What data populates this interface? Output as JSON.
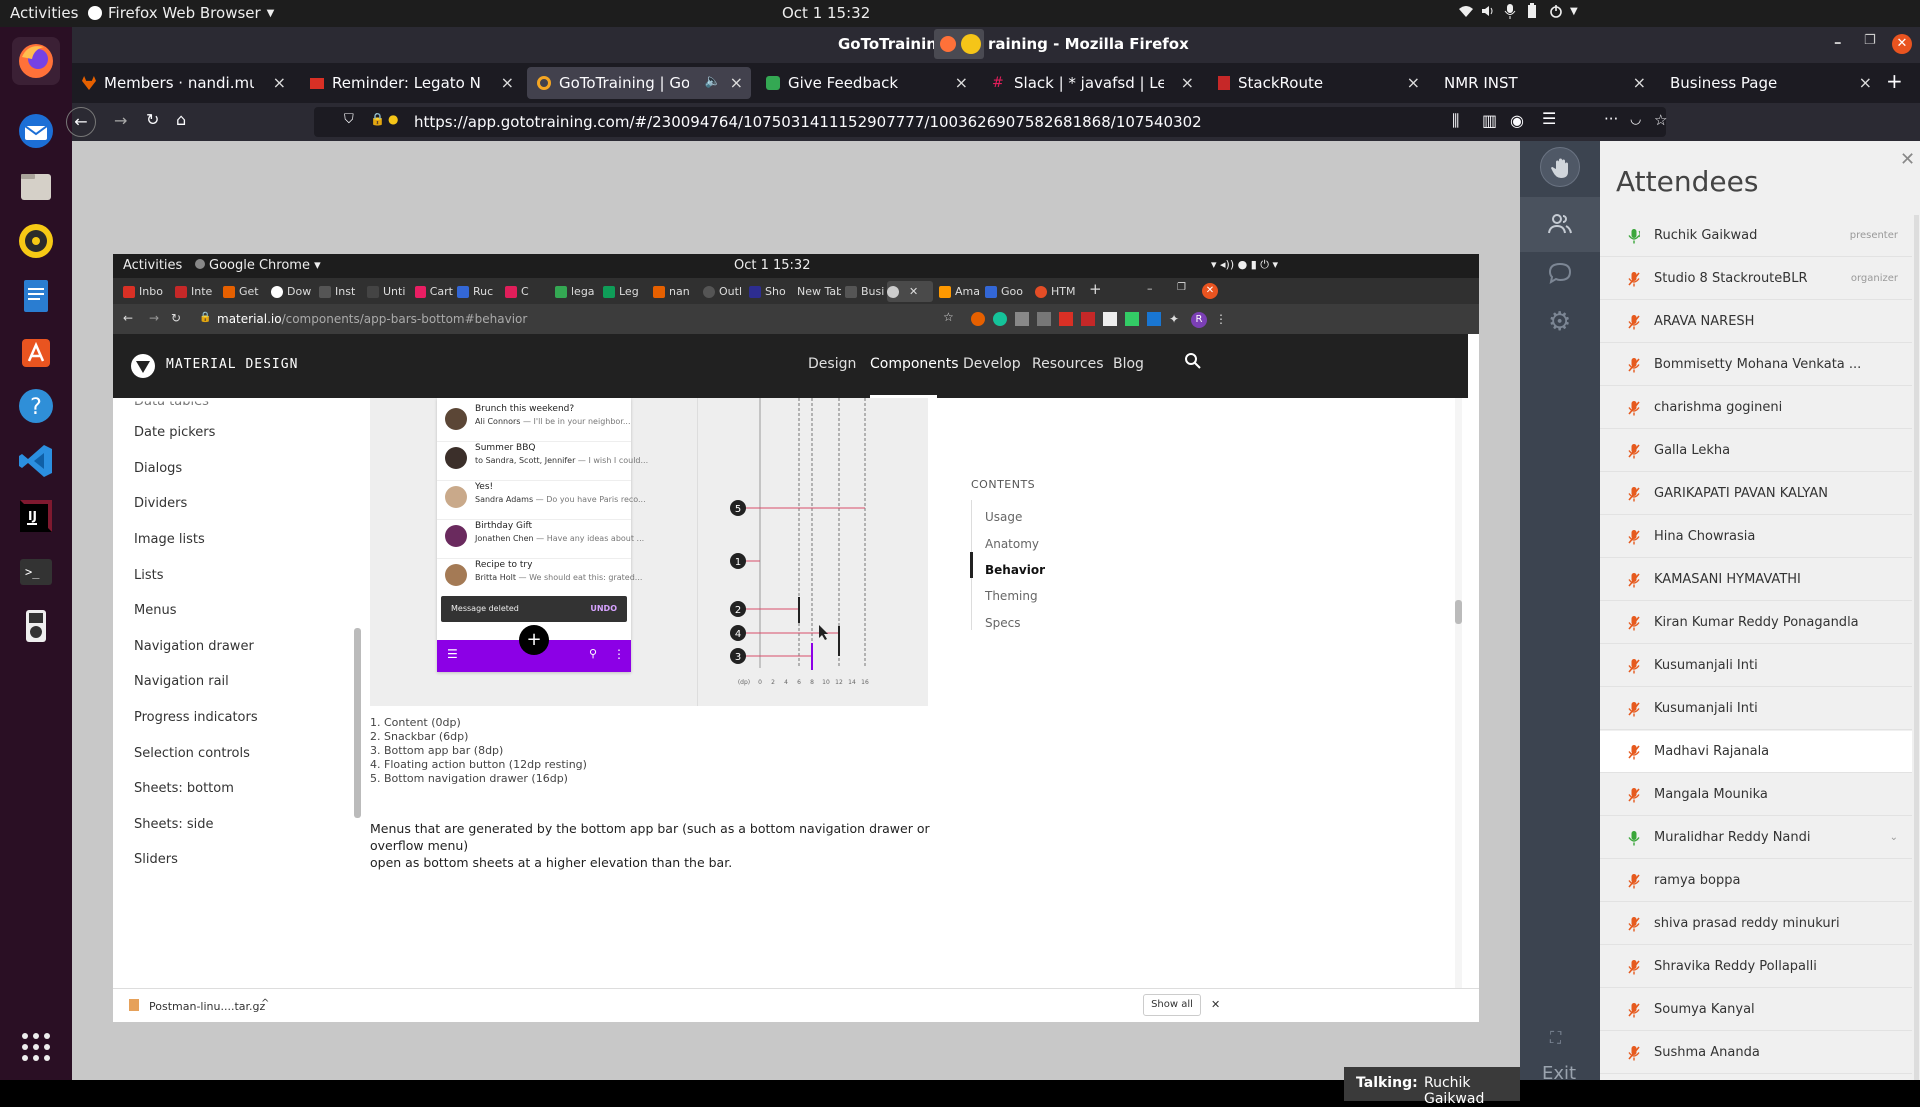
{
  "system": {
    "activities": "Activities",
    "app_menu": "Firefox Web Browser",
    "clock": "Oct 1  15:32"
  },
  "firefox": {
    "window_title": "GoToTraining",
    "window_title_rest": "raining - Mozilla Firefox",
    "tabs": [
      {
        "label": "Members · nandi.muralid",
        "color": "#e66000"
      },
      {
        "label": "Reminder: Legato NHT W",
        "color": "#d93025"
      },
      {
        "label": "GoToTraining | GoToT",
        "color": "#f5a623"
      },
      {
        "label": "Give Feedback",
        "color": "#34a853"
      },
      {
        "label": "Slack | * javafsd | Legato",
        "color": "#e01e5a"
      },
      {
        "label": "StackRoute",
        "color": "#c62828"
      },
      {
        "label": "NMR INST",
        "color": ""
      },
      {
        "label": "Business Page",
        "color": ""
      }
    ],
    "url": "https://app.gototraining.com/#/230094764/1075031411152907777/1003626907582681868/107540302"
  },
  "shared_screen": {
    "activities": "Activities",
    "app_menu": "Google Chrome",
    "clock": "Oct 1  15:32",
    "tabs": [
      "Inbo",
      "Inte",
      "Get",
      "Dow",
      "Inst",
      "Unti",
      "Cart",
      "Ruc",
      "C",
      "lega",
      "Leg",
      "nan",
      "Outl",
      "Sho",
      "New Tab",
      "Busi",
      "",
      "Ama",
      "Goo",
      "HTM"
    ],
    "url_host": "material.io",
    "url_path": "/components/app-bars-bottom#behavior",
    "md_title": "MATERIAL DESIGN",
    "md_nav": [
      "Design",
      "Components",
      "Develop",
      "Resources",
      "Blog"
    ],
    "sidebar": [
      "Data tables",
      "Date pickers",
      "Dialogs",
      "Dividers",
      "Image lists",
      "Lists",
      "Menus",
      "Navigation drawer",
      "Navigation rail",
      "Progress indicators",
      "Selection controls",
      "Sheets: bottom",
      "Sheets: side",
      "Sliders"
    ],
    "emails": [
      {
        "subject": "Brunch this weekend?",
        "from": "Ali Connors",
        "snippet": " — I'll be in your neighbor..."
      },
      {
        "subject": "Summer BBQ",
        "from": "to Sandra, Scott, Jennifer",
        "snippet": " — I wish I could..."
      },
      {
        "subject": "Yes!",
        "from": "Sandra Adams",
        "snippet": " — Do you have Paris reco..."
      },
      {
        "subject": "Birthday Gift",
        "from": "Jonathen Chen",
        "snippet": " — Have any ideas about ..."
      },
      {
        "subject": "Recipe to try",
        "from": "Britta Holt",
        "snippet": " — We should eat this: grated..."
      }
    ],
    "snackbar": {
      "text": "Message deleted",
      "action": "UNDO"
    },
    "elevation_labels": [
      "5",
      "1",
      "2",
      "4",
      "3"
    ],
    "elevation_axis": [
      "(dp)",
      "0",
      "2",
      "4",
      "6",
      "8",
      "10",
      "12",
      "14",
      "16"
    ],
    "contents_title": "CONTENTS",
    "contents": [
      "Usage",
      "Anatomy",
      "Behavior",
      "Theming",
      "Specs"
    ],
    "legend": [
      "1. Content (0dp)",
      "2. Snackbar (6dp)",
      "3. Bottom app bar (8dp)",
      "4. Floating action button (12dp resting)",
      "5. Bottom navigation drawer (16dp)"
    ],
    "paragraph_1": "Menus that are generated by the bottom app bar (such as a bottom navigation drawer or overflow menu)",
    "paragraph_2": "open as bottom sheets at a higher elevation than the bar.",
    "download_file": "Postman-linu....tar.gz",
    "show_all": "Show all"
  },
  "attendees": {
    "title": "Attendees",
    "list": [
      {
        "name": "Ruchik Gaikwad",
        "role": "presenter",
        "mic": "active"
      },
      {
        "name": "Studio 8 StackrouteBLR",
        "role": "organizer",
        "mic": "muted"
      },
      {
        "name": "ARAVA NARESH",
        "role": "",
        "mic": "muted"
      },
      {
        "name": "Bommisetty Mohana Venkata ...",
        "role": "",
        "mic": "muted"
      },
      {
        "name": "charishma gogineni",
        "role": "",
        "mic": "muted"
      },
      {
        "name": "Galla Lekha",
        "role": "",
        "mic": "muted"
      },
      {
        "name": "GARIKAPATI PAVAN KALYAN",
        "role": "",
        "mic": "muted"
      },
      {
        "name": "Hina Chowrasia",
        "role": "",
        "mic": "muted"
      },
      {
        "name": "KAMASANI HYMAVATHI",
        "role": "",
        "mic": "muted"
      },
      {
        "name": "Kiran Kumar Reddy Ponagandla",
        "role": "",
        "mic": "muted"
      },
      {
        "name": "Kusumanjali Inti",
        "role": "",
        "mic": "muted"
      },
      {
        "name": "Kusumanjali Inti",
        "role": "",
        "mic": "muted"
      },
      {
        "name": "Madhavi Rajanala",
        "role": "",
        "mic": "muted"
      },
      {
        "name": "Mangala Mounika",
        "role": "",
        "mic": "muted"
      },
      {
        "name": "Muralidhar Reddy Nandi",
        "role": "",
        "mic": "on"
      },
      {
        "name": "ramya boppa",
        "role": "",
        "mic": "muted"
      },
      {
        "name": "shiva prasad reddy minukuri",
        "role": "",
        "mic": "muted"
      },
      {
        "name": "Shravika Reddy Pollapalli",
        "role": "",
        "mic": "muted"
      },
      {
        "name": "Soumya Kanyal",
        "role": "",
        "mic": "muted"
      },
      {
        "name": "Sushma Ananda",
        "role": "",
        "mic": "muted"
      }
    ],
    "exit_label": "Exit"
  },
  "talking": {
    "label": "Talking:",
    "name": "Ruchik Gaikwad"
  }
}
